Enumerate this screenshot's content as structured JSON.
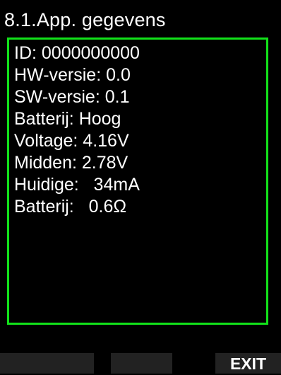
{
  "screen": {
    "title": "8.1.App. gegevens"
  },
  "info_lines": [
    "ID: 0000000000",
    "HW-versie: 0.0",
    "SW-versie: 0.1",
    "Batterij: Hoog",
    "Voltage: 4.16V",
    "Midden: 2.78V",
    "Huidige:   34mA",
    "Batterij:   0.6Ω"
  ],
  "softkeys": {
    "left_label": "",
    "middle_label": "",
    "right_label": "EXIT"
  },
  "colors": {
    "background": "#000000",
    "panel_border": "#12e21a",
    "text": "#ffffff",
    "softkey_background": "#222222"
  }
}
